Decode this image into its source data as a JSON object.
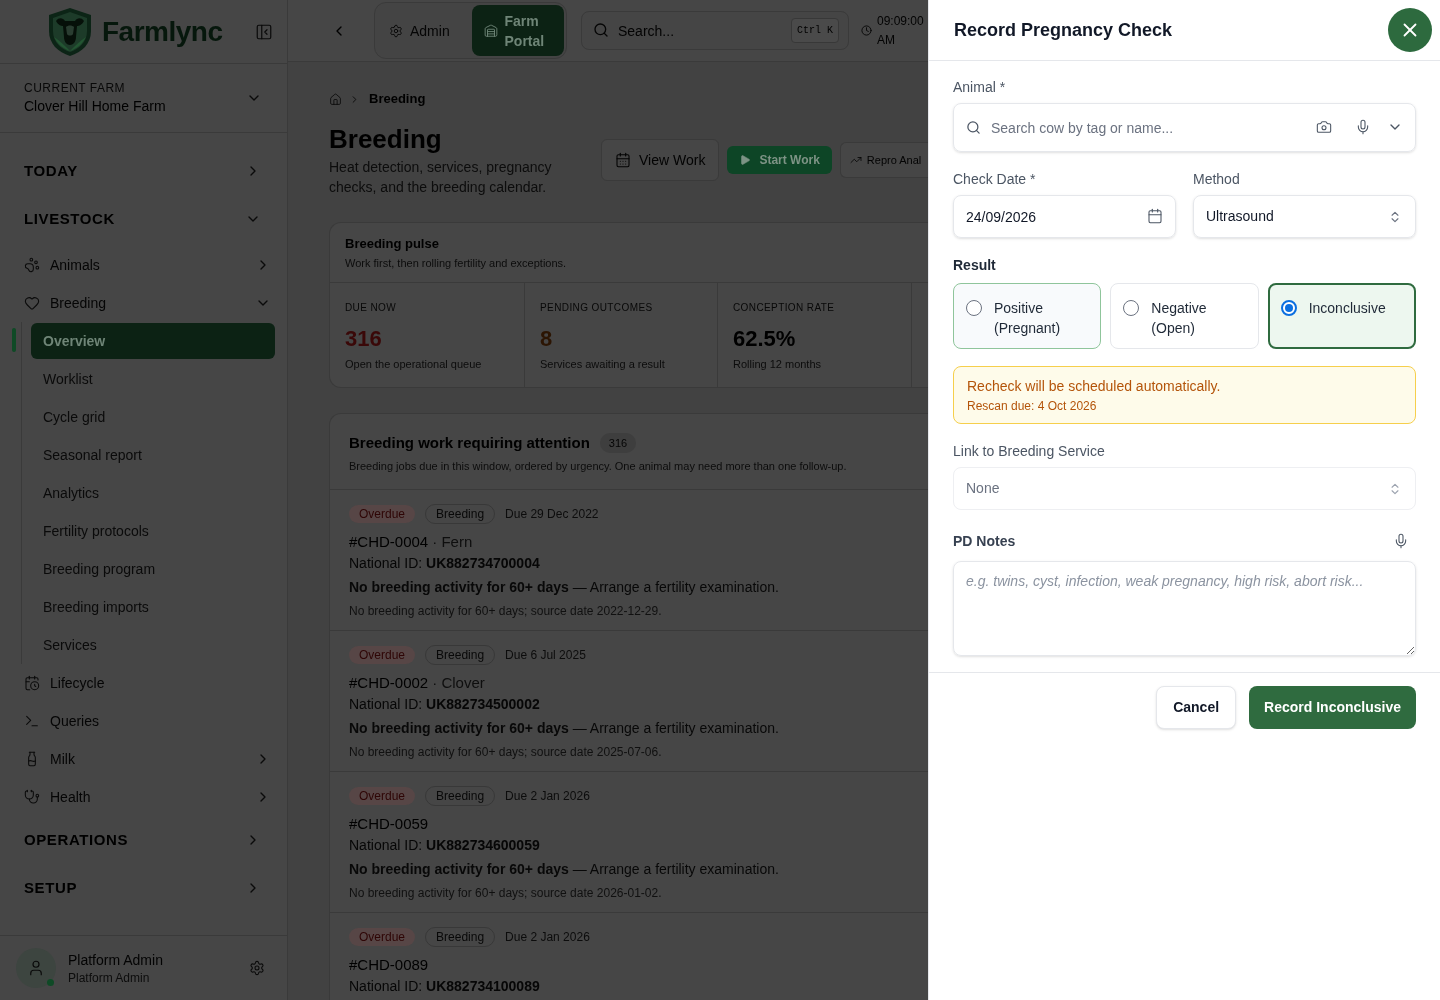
{
  "sidebar": {
    "brand": "Farmlync",
    "farm": {
      "label": "CURRENT FARM",
      "value": "Clover Hill Home Farm"
    },
    "nav": [
      {
        "label": "TODAY",
        "expanded": false
      },
      {
        "label": "LIVESTOCK",
        "expanded": true,
        "children": [
          {
            "kind": "group",
            "label": "Animals",
            "expanded": false
          },
          {
            "kind": "group",
            "label": "Breeding",
            "expanded": true,
            "children": [
              {
                "label": "Overview",
                "selected": true
              },
              {
                "label": "Worklist",
                "selected": false
              },
              {
                "label": "Cycle grid",
                "selected": false
              },
              {
                "label": "Seasonal report",
                "selected": false
              },
              {
                "label": "Analytics",
                "selected": false
              },
              {
                "label": "Fertility protocols",
                "selected": false
              },
              {
                "label": "Breeding program",
                "selected": false
              },
              {
                "label": "Breeding imports",
                "selected": false
              },
              {
                "label": "Services",
                "selected": false
              }
            ]
          },
          {
            "kind": "link",
            "label": "Lifecycle"
          },
          {
            "kind": "link",
            "label": "Queries"
          },
          {
            "kind": "group",
            "label": "Milk",
            "expanded": false
          },
          {
            "kind": "group",
            "label": "Health",
            "expanded": false
          }
        ]
      },
      {
        "label": "OPERATIONS",
        "expanded": false
      },
      {
        "label": "SETUP",
        "expanded": false
      }
    ],
    "user": {
      "name": "Platform Admin",
      "role": "Platform Admin",
      "online": true
    }
  },
  "topbar": {
    "modes": [
      {
        "label": "Admin",
        "selected": false
      },
      {
        "label": "Farm Portal",
        "selected": true
      }
    ],
    "search": {
      "placeholder": "Search...",
      "shortcut": "Ctrl K"
    },
    "time": "09:09:00 AM"
  },
  "page": {
    "breadcrumb": [
      "Breeding"
    ],
    "title": "Breeding",
    "subtitle": "Heat detection, services, pregnancy checks, and the breeding calendar.",
    "actions": [
      {
        "kind": "secondary",
        "label": "View Work"
      },
      {
        "kind": "primary",
        "label": "Start Work"
      },
      {
        "kind": "outline",
        "label": "Repro Anal"
      }
    ],
    "pulse": {
      "title": "Breeding pulse",
      "subtitle": "Work first, then rolling fertility and exceptions.",
      "stats": [
        {
          "label": "DUE NOW",
          "value": "316",
          "caption": "Open the operational queue",
          "color": "#3a0808"
        },
        {
          "label": "PENDING OUTCOMES",
          "value": "8",
          "caption": "Services awaiting a result",
          "color": "#2c1503"
        },
        {
          "label": "CONCEPTION RATE",
          "value": "62.5%",
          "caption": "Rolling 12 months",
          "color": "#000000"
        }
      ]
    },
    "worklist": {
      "title": "Breeding work requiring attention",
      "count": "316",
      "subtitle": "Breeding jobs due in this window, ordered by urgency. One animal may need more than one follow-up.",
      "items": [
        {
          "status": "Overdue",
          "category": "Breeding",
          "due": "Due 29 Dec 2022",
          "tag": "#CHD-0004",
          "name": "· Fern",
          "national_id": "National ID: **UK882734700004**",
          "activity": "**No breeding activity for 60+ days** — Arrange a fertility examination.",
          "note": "No breeding activity for 60+ days; source date 2022-12-29."
        },
        {
          "status": "Overdue",
          "category": "Breeding",
          "due": "Due 6 Jul 2025",
          "tag": "#CHD-0002",
          "name": "· Clover",
          "national_id": "National ID: **UK882734500002**",
          "activity": "**No breeding activity for 60+ days** — Arrange a fertility examination.",
          "note": "No breeding activity for 60+ days; source date 2025-07-06."
        },
        {
          "status": "Overdue",
          "category": "Breeding",
          "due": "Due 2 Jan 2026",
          "tag": "#CHD-0059",
          "national_id": "National ID: **UK882734600059**",
          "activity": "**No breeding activity for 60+ days** — Arrange a fertility examination.",
          "note": "No breeding activity for 60+ days; source date 2026-01-02."
        },
        {
          "status": "Overdue",
          "category": "Breeding",
          "due": "Due 2 Jan 2026",
          "tag": "#CHD-0089",
          "national_id": "National ID: **UK882734100089**"
        }
      ]
    }
  },
  "drawer": {
    "title": "Record Pregnancy Check",
    "animal": {
      "label": "Animal *",
      "placeholder": "Search cow by tag or name..."
    },
    "check_date": {
      "label": "Check Date *",
      "value": "24/09/2026"
    },
    "method": {
      "label": "Method",
      "value": "Ultrasound"
    },
    "result": {
      "label": "Result",
      "options": [
        {
          "label": "Positive (Pregnant)",
          "selected": false,
          "hovered": true
        },
        {
          "label": "Negative (Open)",
          "selected": false,
          "hovered": false
        },
        {
          "label": "Inconclusive",
          "selected": true,
          "hovered": false
        }
      ]
    },
    "notice": {
      "message": "Recheck will be scheduled automatically.",
      "detail": "Rescan due: 4 Oct 2026"
    },
    "breeding_service": {
      "label": "Link to Breeding Service",
      "value": "None",
      "disabled": true
    },
    "notes": {
      "label": "PD Notes",
      "placeholder": "e.g. twins, cyst, infection, weak pregnancy, high risk, abort risk..."
    },
    "buttons": [
      {
        "kind": "secondary",
        "label": "Cancel"
      },
      {
        "kind": "primary",
        "label": "Record Inconclusive"
      }
    ]
  }
}
